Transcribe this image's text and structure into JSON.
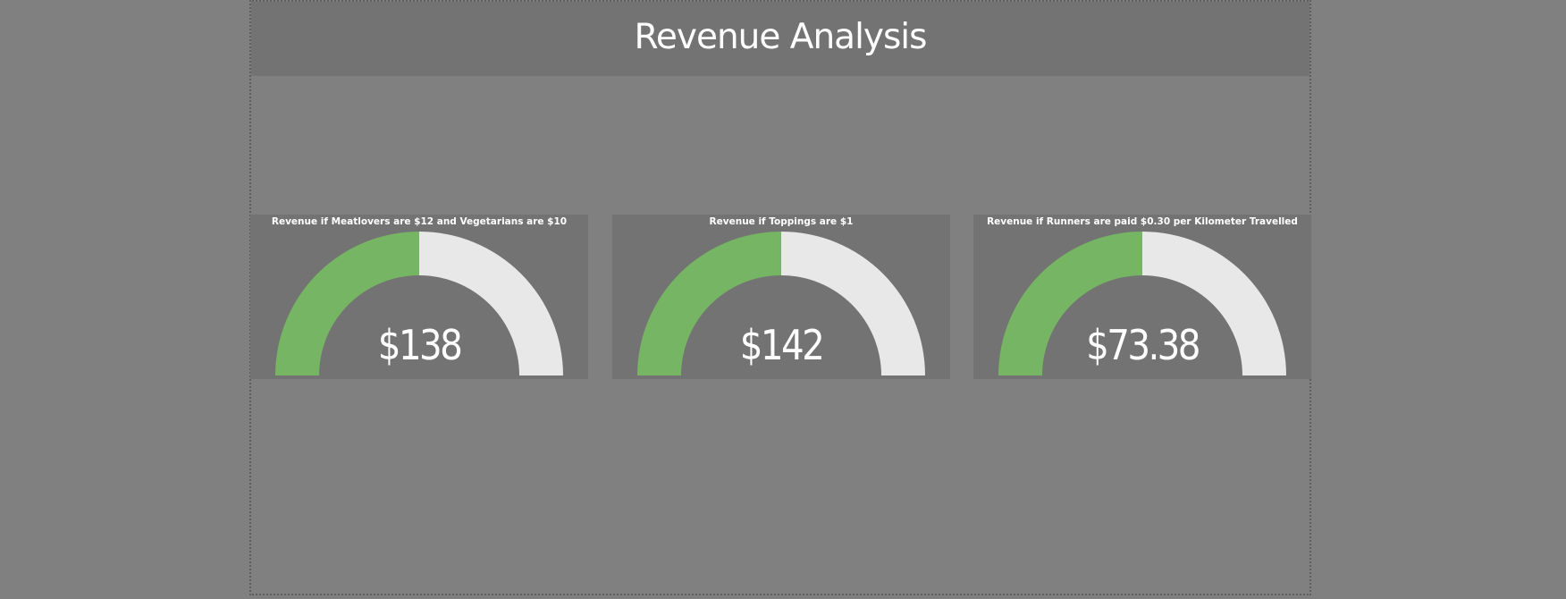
{
  "page": {
    "title": "Revenue Analysis"
  },
  "colors": {
    "background": "#808080",
    "card": "#737373",
    "gauge_fill": "#76b563",
    "gauge_track": "#e8e8e8",
    "text": "#ffffff"
  },
  "gauges": [
    {
      "title": "Revenue if Meatlovers are $12 and Vegetarians are $10",
      "value_label": "$138",
      "fill_fraction": 0.5
    },
    {
      "title": "Revenue if Toppings are $1",
      "value_label": "$142",
      "fill_fraction": 0.5
    },
    {
      "title": "Revenue if Runners are paid $0.30 per Kilometer Travelled",
      "value_label": "$73.38",
      "fill_fraction": 0.5
    }
  ]
}
